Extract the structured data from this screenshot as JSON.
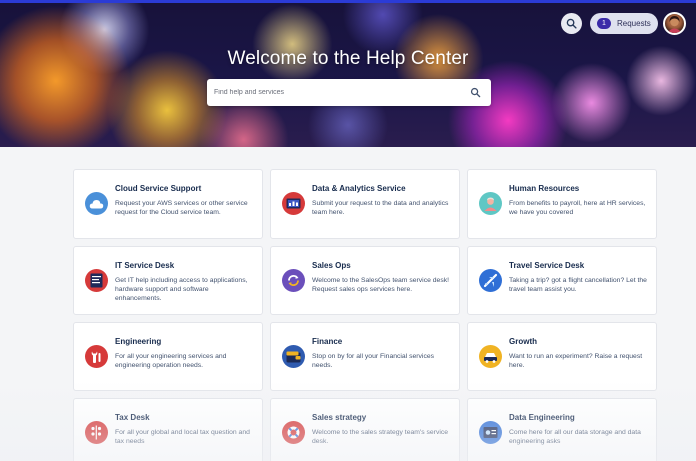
{
  "hero": {
    "title": "Welcome to the Help Center",
    "search_placeholder": "Find help and services"
  },
  "header": {
    "requests_count": "1",
    "requests_label": "Requests"
  },
  "cards": [
    {
      "title": "Cloud Service Support",
      "desc": "Request your AWS services or other service request for the Cloud service team.",
      "icon": "cloud-icon",
      "color": "#4a90d9"
    },
    {
      "title": "Data & Analytics Service",
      "desc": "Submit your request to the data and analytics team here.",
      "icon": "analytics-icon",
      "color": "#d63a3a"
    },
    {
      "title": "Human Resources",
      "desc": "From benefits to payroll, here at HR services, we have you covered",
      "icon": "person-icon",
      "color": "#5fc7c4"
    },
    {
      "title": "IT Service Desk",
      "desc": "Get IT help including access to applications, hardware support and software enhancements.",
      "icon": "document-icon",
      "color": "#d63a3a"
    },
    {
      "title": "Sales Ops",
      "desc": "Welcome to the SalesOps team service desk! Request sales ops services here.",
      "icon": "refresh-icon",
      "color": "#6b4fbb"
    },
    {
      "title": "Travel Service Desk",
      "desc": "Taking a trip? got a flight cancellation? Let the travel team assist you.",
      "icon": "airplane-icon",
      "color": "#2f6fd6"
    },
    {
      "title": "Engineering",
      "desc": "For all your engineering services and engineering operation needs.",
      "icon": "wrench-icon",
      "color": "#d63a3a"
    },
    {
      "title": "Finance",
      "desc": "Stop on by for all your Financial services needs.",
      "icon": "wallet-icon",
      "color": "#2f5bb0"
    },
    {
      "title": "Growth",
      "desc": "Want to run an experiment? Raise a request here.",
      "icon": "car-icon",
      "color": "#f0b323"
    },
    {
      "title": "Tax Desk",
      "desc": "For all your global and local tax question and tax needs",
      "icon": "calculator-icon",
      "color": "#d63a3a"
    },
    {
      "title": "Sales strategy",
      "desc": "Welcome to the sales strategy team's service desk.",
      "icon": "lifebuoy-icon",
      "color": "#d63a3a"
    },
    {
      "title": "Data Engineering",
      "desc": "Come here for all our data storage and data engineering asks",
      "icon": "database-icon",
      "color": "#2f6fd6"
    }
  ]
}
